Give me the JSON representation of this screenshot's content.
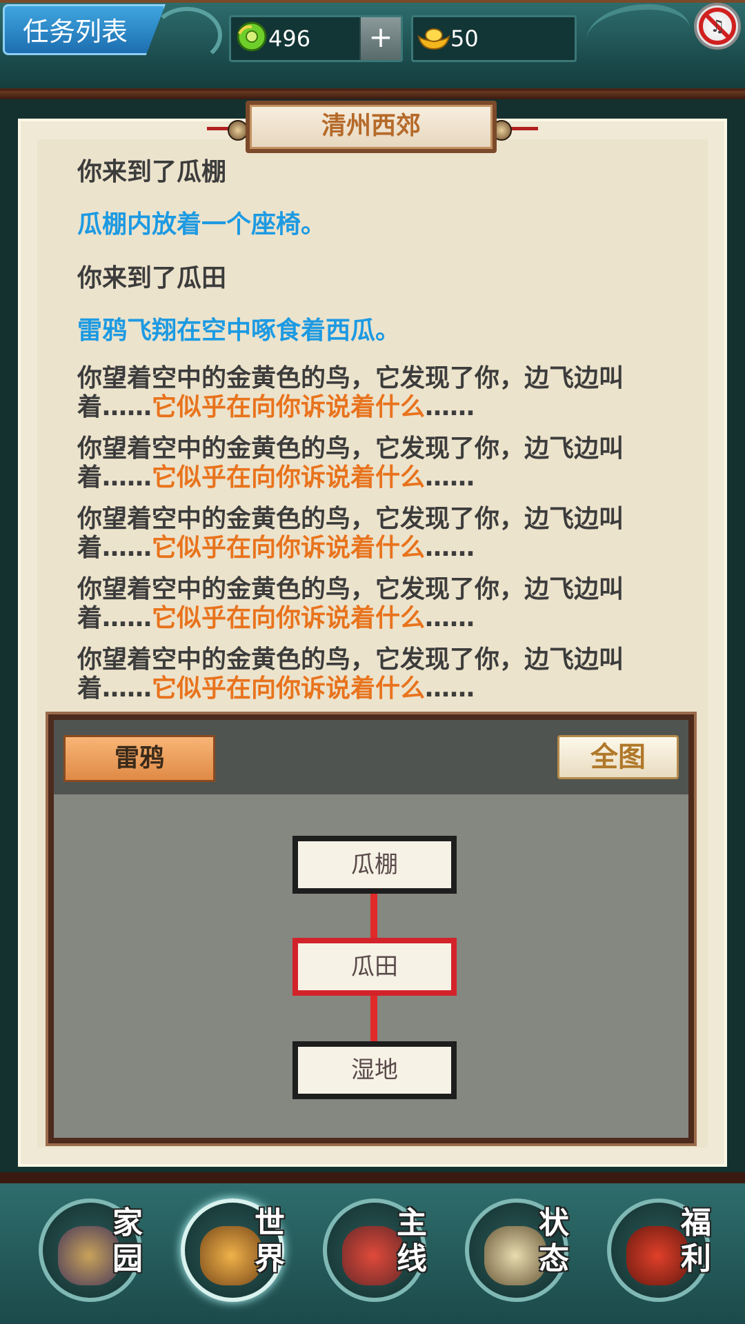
{
  "topbar": {
    "quest_list_label": "任务列表",
    "jade_count": "496",
    "plus_label": "+",
    "gold_count": "50",
    "jade_icon": "green-jade-icon",
    "gold_icon": "gold-ingot-icon",
    "mute_icon": "mute-icon"
  },
  "location": {
    "title": "清州西郊"
  },
  "log": {
    "line1": "你来到了瓜棚",
    "line2": "瓜棚内放着一个座椅。",
    "line3": "你来到了瓜田",
    "line4": "雷鸦飞翔在空中啄食着西瓜。",
    "bird_lines": [
      {
        "prefix": "你望着空中的金黄色的鸟，它发现了你，边飞边叫着……",
        "highlight": "它似乎在向你诉说着什么",
        "suffix": "……"
      },
      {
        "prefix": "你望着空中的金黄色的鸟，它发现了你，边飞边叫着……",
        "highlight": "它似乎在向你诉说着什么",
        "suffix": "……"
      },
      {
        "prefix": "你望着空中的金黄色的鸟，它发现了你，边飞边叫着……",
        "highlight": "它似乎在向你诉说着什么",
        "suffix": "……"
      },
      {
        "prefix": "你望着空中的金黄色的鸟，它发现了你，边飞边叫着……",
        "highlight": "它似乎在向你诉说着什么",
        "suffix": "……"
      },
      {
        "prefix": "你望着空中的金黄色的鸟，它发现了你，边飞边叫着……",
        "highlight": "它似乎在向你诉说着什么",
        "suffix": "……"
      }
    ]
  },
  "map": {
    "npc_button": "雷鸦",
    "full_map_button": "全图",
    "nodes": [
      "瓜棚",
      "瓜田",
      "湿地"
    ],
    "current_node": "瓜田"
  },
  "nav": {
    "items": [
      {
        "label_top": "家",
        "label_bottom": "园",
        "icon": "home-icon"
      },
      {
        "label_top": "世",
        "label_bottom": "界",
        "icon": "world-icon"
      },
      {
        "label_top": "主",
        "label_bottom": "线",
        "icon": "main-quest-icon"
      },
      {
        "label_top": "状",
        "label_bottom": "态",
        "icon": "bagua-status-icon"
      },
      {
        "label_top": "福",
        "label_bottom": "利",
        "icon": "gift-bag-icon"
      }
    ],
    "active": "世界"
  },
  "colors": {
    "accent_blue": "#1d9ae2",
    "highlight_orange": "#e8731d",
    "current_node_red": "#d3232a"
  }
}
